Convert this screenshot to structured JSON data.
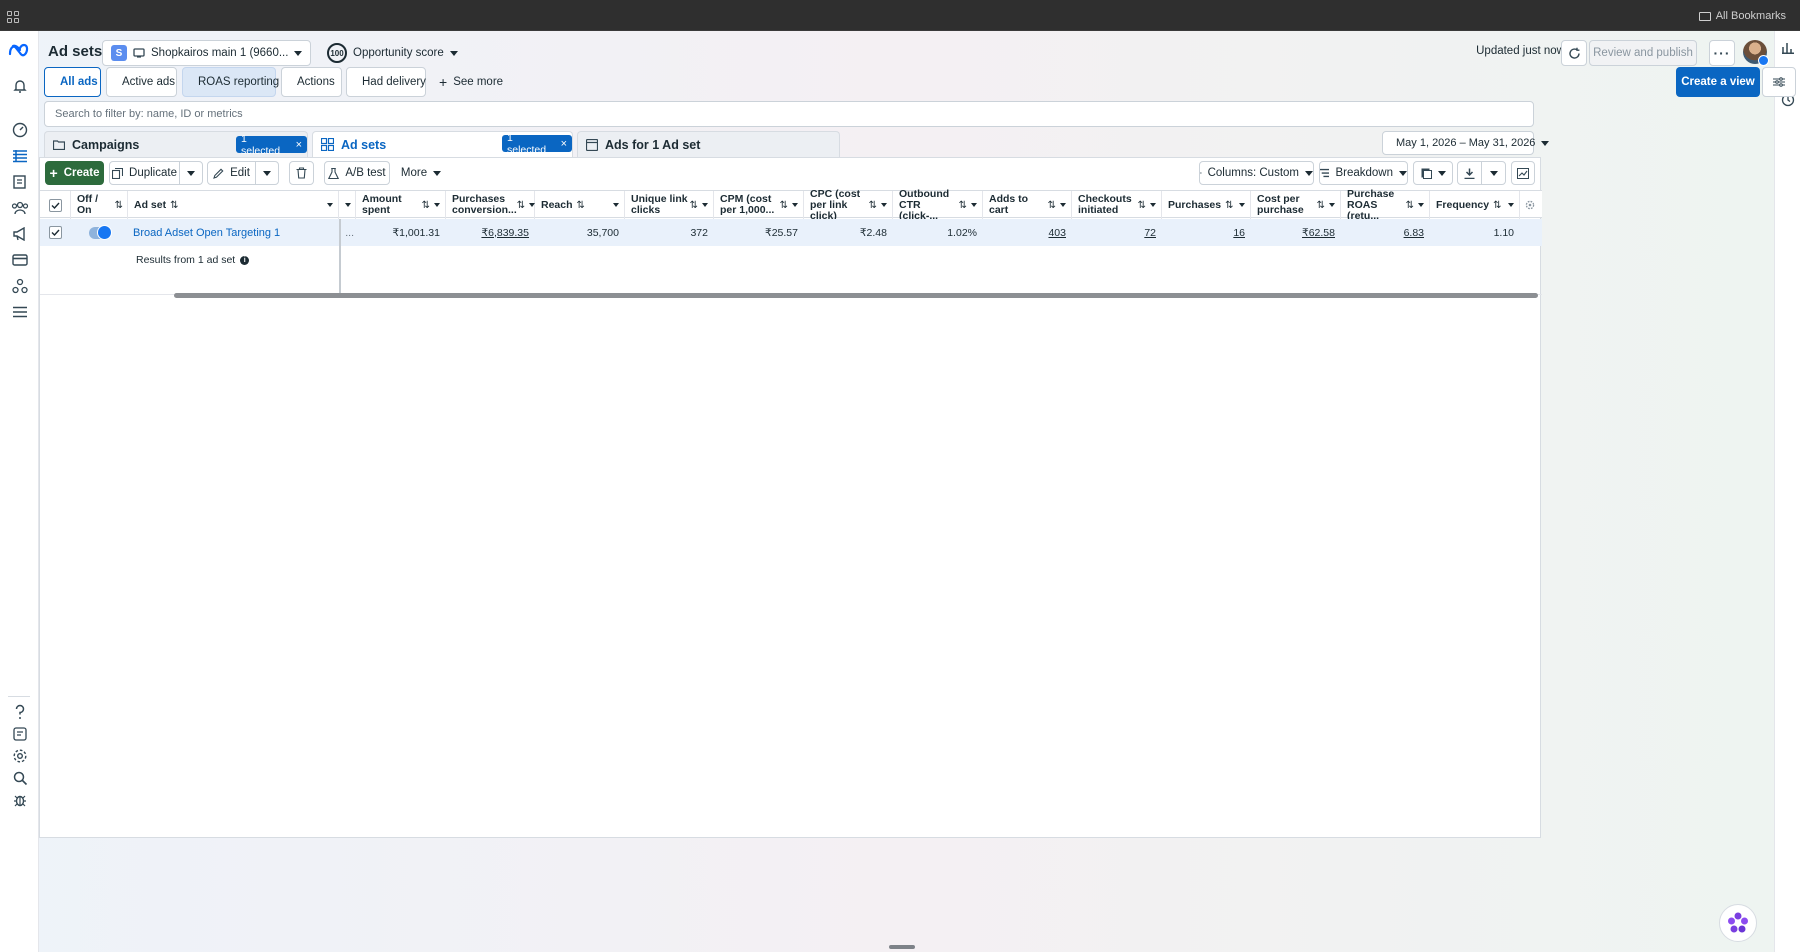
{
  "browser": {
    "bookmarks_label": "All Bookmarks"
  },
  "header": {
    "title": "Ad sets",
    "account": {
      "badge": "S",
      "name": "Shopkairos main 1 (9660..."
    },
    "opportunity": {
      "score": "100",
      "label": "Opportunity score"
    },
    "updated": "Updated just now",
    "review_label": "Review and publish"
  },
  "views": {
    "tabs": [
      "All ads",
      "Active ads",
      "ROAS reporting",
      "Actions",
      "Had delivery",
      "See more"
    ],
    "create_view": "Create a view"
  },
  "search": {
    "placeholder": "Search to filter by: name, ID or metrics"
  },
  "levels": {
    "campaigns": "Campaigns",
    "campaigns_selected": "1 selected",
    "adsets": "Ad sets",
    "adsets_selected": "1 selected",
    "ads": "Ads for 1 Ad set"
  },
  "date_range": "May 1, 2026 – May 31, 2026",
  "toolbar": {
    "create": "Create",
    "duplicate": "Duplicate",
    "edit": "Edit",
    "ab_test": "A/B test",
    "more": "More",
    "columns": "Columns: Custom",
    "breakdown": "Breakdown"
  },
  "table": {
    "columns": {
      "off_on": "Off / On",
      "adset": "Ad set",
      "amount_spent": "Amount spent",
      "purchases_conv": "Purchases conversion...",
      "reach": "Reach",
      "unique_link_clicks": "Unique link clicks",
      "cpm": "CPM (cost per 1,000...",
      "cpc": "CPC (cost per link click)",
      "outbound_ctr": "Outbound CTR (click-...",
      "adds_to_cart": "Adds to cart",
      "checkouts": "Checkouts initiated",
      "purchases": "Purchases",
      "cost_per_purchase": "Cost per purchase",
      "purchase_roas": "Purchase ROAS (retu...",
      "frequency": "Frequency"
    },
    "row": {
      "adset_name": "Broad Adset Open Targeting 1",
      "truncated": "...",
      "amount_spent": "₹1,001.31",
      "purchases_conv": "₹6,839.35",
      "reach": "35,700",
      "unique_link_clicks": "372",
      "cpm": "₹25.57",
      "cpc": "₹2.48",
      "outbound_ctr": "1.02%",
      "adds_to_cart": "403",
      "checkouts": "72",
      "purchases": "16",
      "cost_per_purchase": "₹62.58",
      "purchase_roas": "6.83",
      "frequency": "1.10"
    },
    "results_label": "Results from 1 ad set"
  },
  "colors": {
    "accent": "#0a66c2",
    "create": "#2d6b3c",
    "row_selected": "#e9f1fb"
  }
}
